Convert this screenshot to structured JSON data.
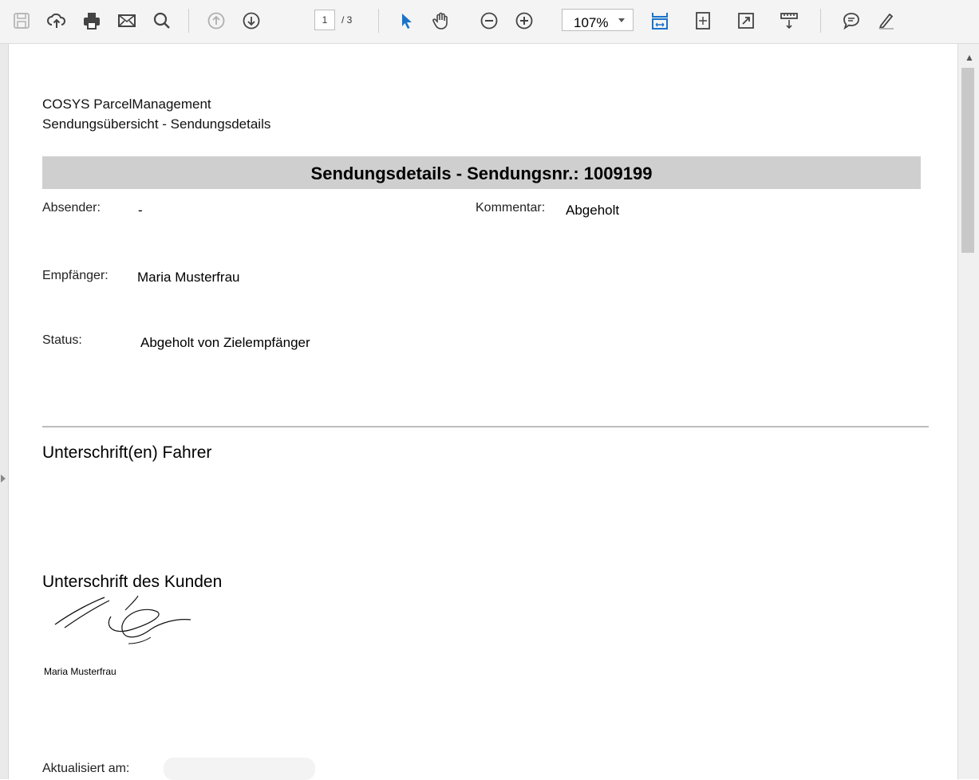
{
  "toolbar": {
    "page_current": "1",
    "page_total": "/ 3",
    "zoom": "107%",
    "icons": [
      "save-icon",
      "upload-icon",
      "print-icon",
      "mail-icon",
      "search-icon",
      "prev-page-icon",
      "next-page-icon",
      "select-arrow-icon",
      "hand-icon",
      "zoom-out-icon",
      "zoom-in-icon",
      "fit-width-icon",
      "fit-page-icon",
      "full-screen-icon",
      "ruler-icon",
      "comment-icon",
      "highlight-pen-icon"
    ],
    "accent_color": "#1a73c9"
  },
  "document": {
    "app_name": "COSYS ParcelManagement",
    "breadcrumb": "Sendungsübersicht - Sendungsdetails",
    "title": "Sendungsdetails - Sendungsnr.: 1009199",
    "fields": {
      "sender_label": "Absender:",
      "sender_value": "-",
      "comment_label": "Kommentar:",
      "comment_value": "Abgeholt",
      "recipient_label": "Empfänger:",
      "recipient_value": "Maria Musterfrau",
      "status_label": "Status:",
      "status_value": "Abgeholt von Zielempfänger"
    },
    "driver_signature_heading": "Unterschrift(en) Fahrer",
    "customer_signature_heading": "Unterschrift des Kunden",
    "customer_signature_name": "Maria Musterfrau",
    "updated_label": "Aktualisiert am:"
  }
}
